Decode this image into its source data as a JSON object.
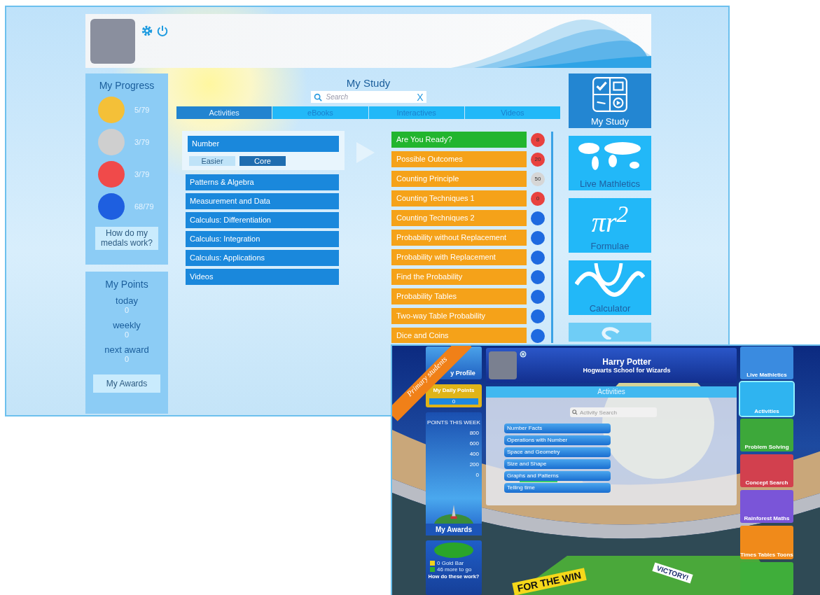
{
  "study_app": {
    "progress": {
      "title": "My Progress",
      "medals": [
        {
          "color": "#f4c038",
          "count": "5/79"
        },
        {
          "color": "#cfcfcf",
          "count": "3/79"
        },
        {
          "color": "#f04a4a",
          "count": "3/79"
        },
        {
          "color": "#1e5fe0",
          "count": "68/79"
        }
      ],
      "help_button": "How do my medals work?"
    },
    "points": {
      "title": "My Points",
      "rows": [
        {
          "label": "today",
          "value": "0"
        },
        {
          "label": "weekly",
          "value": "0"
        },
        {
          "label": "next award",
          "value": "0"
        }
      ],
      "awards_button": "My Awards"
    },
    "study": {
      "title": "My Study",
      "search": {
        "placeholder": "Search",
        "clear": "X"
      },
      "tabs": [
        {
          "label": "Activities",
          "selected": true
        },
        {
          "label": "eBooks",
          "selected": false
        },
        {
          "label": "Interactives",
          "selected": false
        },
        {
          "label": "Videos",
          "selected": false
        }
      ],
      "topics": [
        {
          "label": "Number",
          "selected": true
        },
        {
          "label": "Patterns & Algebra",
          "selected": false
        },
        {
          "label": "Measurement and Data",
          "selected": false
        },
        {
          "label": "Calculus: Differentiation",
          "selected": false
        },
        {
          "label": "Calculus: Integration",
          "selected": false
        },
        {
          "label": "Calculus: Applications",
          "selected": false
        },
        {
          "label": "Videos",
          "selected": false
        }
      ],
      "levels": [
        {
          "label": "Easier",
          "selected": false
        },
        {
          "label": "Core",
          "selected": true
        }
      ],
      "lessons": [
        {
          "label": "Are You Ready?",
          "color": "#22b52e",
          "badge": {
            "color": "#e8423f",
            "count": "8"
          }
        },
        {
          "label": "Possible Outcomes",
          "color": "#f5a219",
          "badge": {
            "color": "#e8423f",
            "count": "20"
          }
        },
        {
          "label": "Counting Principle",
          "color": "#f5a219",
          "badge": {
            "color": "#d6d6d6",
            "count": "50"
          }
        },
        {
          "label": "Counting Techniques 1",
          "color": "#f5a219",
          "badge": {
            "color": "#e8423f",
            "count": "0"
          }
        },
        {
          "label": "Counting Techniques 2",
          "color": "#f5a219",
          "badge": {
            "color": "#1e6ae0"
          }
        },
        {
          "label": "Probability without Replacement",
          "color": "#f5a219",
          "badge": {
            "color": "#1e6ae0"
          }
        },
        {
          "label": "Probability with Replacement",
          "color": "#f5a219",
          "badge": {
            "color": "#1e6ae0"
          }
        },
        {
          "label": "Find the Probability",
          "color": "#f5a219",
          "badge": {
            "color": "#1e6ae0"
          }
        },
        {
          "label": "Probability Tables",
          "color": "#f5a219",
          "badge": {
            "color": "#1e6ae0"
          }
        },
        {
          "label": "Two-way Table Probability",
          "color": "#f5a219",
          "badge": {
            "color": "#1e6ae0"
          }
        },
        {
          "label": "Dice and Coins",
          "color": "#f5a219",
          "badge": {
            "color": "#1e6ae0"
          }
        }
      ]
    },
    "tiles": [
      {
        "kind": "study",
        "label": "My Study",
        "selected": true
      },
      {
        "kind": "map",
        "label": "Live Mathletics",
        "selected": false
      },
      {
        "kind": "formula",
        "label": "Formulae",
        "formula": "πr$^{2}$",
        "selected": false
      },
      {
        "kind": "wave",
        "label": "Calculator",
        "selected": false
      },
      {
        "kind": "cut"
      }
    ]
  },
  "primary_app": {
    "ribbon": "Primary students",
    "profile_tile": "y Profile",
    "daily_points": {
      "label": "My Daily Points",
      "value": "0"
    },
    "week": {
      "title": "POINTS THIS WEEK",
      "scale": [
        "800",
        "600",
        "400",
        "200",
        "0"
      ],
      "awards": "My Awards"
    },
    "gold": {
      "rows": [
        {
          "color": "#f2d21c",
          "label": "0 Gold Bar"
        },
        {
          "color": "#2fae2f",
          "label": "46 more to go"
        }
      ],
      "help": "How do these work?"
    },
    "user": {
      "name": "Harry Potter",
      "school": "Hogwarts School for Wizards"
    },
    "activities": {
      "title": "Activities",
      "search": {
        "placeholder": "Activity Search"
      },
      "items": [
        {
          "label": "Number Facts"
        },
        {
          "label": "Operations with Number"
        },
        {
          "label": "Space and Geometry"
        },
        {
          "label": "Size and Shape"
        },
        {
          "label": "Graphs and Patterns",
          "level": 0.6
        },
        {
          "label": "Telling time"
        }
      ]
    },
    "tiles": [
      {
        "label": "Live Mathletics",
        "color": "#3a8be0",
        "selected": false
      },
      {
        "label": "Activities",
        "color": "#2fb4f0",
        "selected": true
      },
      {
        "label": "Problem Solving",
        "color": "#3da83a",
        "selected": false
      },
      {
        "label": "Concept Search",
        "color": "#d2404e",
        "selected": false
      },
      {
        "label": "Rainforest Maths",
        "color": "#7a55d8",
        "selected": false
      },
      {
        "label": "Times Tables Toons",
        "color": "#f08a1a",
        "selected": false
      },
      {
        "color": "#3fae3a",
        "selected": false
      }
    ],
    "banners": [
      "FOR THE WIN",
      "VICTORY!"
    ]
  }
}
